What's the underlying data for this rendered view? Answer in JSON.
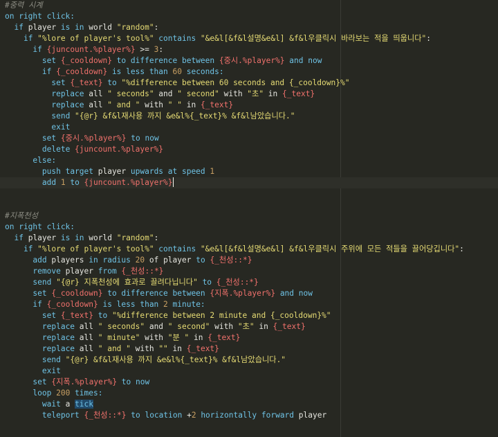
{
  "editor": {
    "lines": [
      {
        "indent": 0,
        "tokens": [
          [
            "c",
            "#중력 시계"
          ]
        ]
      },
      {
        "indent": 0,
        "tokens": [
          [
            "k",
            "on right click:"
          ]
        ]
      },
      {
        "indent": 1,
        "tokens": [
          [
            "k",
            "if "
          ],
          [
            "w",
            "player "
          ],
          [
            "k",
            "is in "
          ],
          [
            "w",
            "world "
          ],
          [
            "s",
            "\"random\""
          ],
          [
            "w",
            ":"
          ]
        ]
      },
      {
        "indent": 2,
        "tokens": [
          [
            "k",
            "if "
          ],
          [
            "s",
            "\"%lore of player's tool%\" "
          ],
          [
            "k",
            "contains "
          ],
          [
            "s",
            "\"&e&l[&f&l설명&e&l] &f&l우클릭시 바라보는 적을 띄웁니다\""
          ],
          [
            "w",
            ":"
          ]
        ]
      },
      {
        "indent": 3,
        "tokens": [
          [
            "k",
            "if "
          ],
          [
            "v",
            "{juncount.%player%}"
          ],
          [
            "w",
            " >= "
          ],
          [
            "n",
            "3"
          ],
          [
            "w",
            ":"
          ]
        ]
      },
      {
        "indent": 4,
        "tokens": [
          [
            "k",
            "set "
          ],
          [
            "v",
            "{_cooldown}"
          ],
          [
            "k",
            " to difference between "
          ],
          [
            "v",
            "{중시.%player%}"
          ],
          [
            "k",
            " and now"
          ]
        ]
      },
      {
        "indent": 4,
        "tokens": [
          [
            "k",
            "if "
          ],
          [
            "v",
            "{_cooldown}"
          ],
          [
            "k",
            " is less than "
          ],
          [
            "n",
            "60 "
          ],
          [
            "k",
            "seconds:"
          ]
        ]
      },
      {
        "indent": 5,
        "tokens": [
          [
            "k",
            "set "
          ],
          [
            "v",
            "{_text}"
          ],
          [
            "k",
            " to "
          ],
          [
            "s",
            "\"%difference between 60 seconds and {_cooldown}%\""
          ]
        ]
      },
      {
        "indent": 5,
        "tokens": [
          [
            "k",
            "replace "
          ],
          [
            "w",
            "all "
          ],
          [
            "s",
            "\" seconds\""
          ],
          [
            "w",
            " and "
          ],
          [
            "s",
            "\" second\""
          ],
          [
            "w",
            " with "
          ],
          [
            "s",
            "\"초\""
          ],
          [
            "w",
            " in "
          ],
          [
            "v",
            "{_text}"
          ]
        ]
      },
      {
        "indent": 5,
        "tokens": [
          [
            "k",
            "replace "
          ],
          [
            "w",
            "all "
          ],
          [
            "s",
            "\" and \""
          ],
          [
            "w",
            " with "
          ],
          [
            "s",
            "\" \""
          ],
          [
            "w",
            " in "
          ],
          [
            "v",
            "{_text}"
          ]
        ]
      },
      {
        "indent": 5,
        "tokens": [
          [
            "k",
            "send "
          ],
          [
            "s",
            "\"{@r} &f&l재사용 까지 &e&l%{_text}% &f&l남았습니다.\""
          ]
        ]
      },
      {
        "indent": 5,
        "tokens": [
          [
            "k",
            "exit"
          ]
        ]
      },
      {
        "indent": 4,
        "tokens": [
          [
            "k",
            "set "
          ],
          [
            "v",
            "{중시.%player%}"
          ],
          [
            "k",
            " to now"
          ]
        ]
      },
      {
        "indent": 4,
        "tokens": [
          [
            "k",
            "delete "
          ],
          [
            "v",
            "{juncount.%player%}"
          ]
        ]
      },
      {
        "indent": 3,
        "tokens": [
          [
            "k",
            "else:"
          ]
        ]
      },
      {
        "indent": 4,
        "tokens": [
          [
            "k",
            "push "
          ],
          [
            "k",
            "target "
          ],
          [
            "w",
            "player "
          ],
          [
            "k",
            "upwards at speed "
          ],
          [
            "n",
            "1"
          ]
        ]
      },
      {
        "indent": 4,
        "active": true,
        "cursor": true,
        "tokens": [
          [
            "k",
            "add "
          ],
          [
            "n",
            "1"
          ],
          [
            "k",
            " to "
          ],
          [
            "v",
            "{juncount.%player%}"
          ]
        ]
      },
      {
        "indent": 0,
        "tokens": []
      },
      {
        "indent": 0,
        "tokens": []
      },
      {
        "indent": 0,
        "tokens": [
          [
            "c",
            "#지폭천성"
          ]
        ]
      },
      {
        "indent": 0,
        "tokens": [
          [
            "k",
            "on right click:"
          ]
        ]
      },
      {
        "indent": 1,
        "tokens": [
          [
            "k",
            "if "
          ],
          [
            "w",
            "player "
          ],
          [
            "k",
            "is in "
          ],
          [
            "w",
            "world "
          ],
          [
            "s",
            "\"random\""
          ],
          [
            "w",
            ":"
          ]
        ]
      },
      {
        "indent": 2,
        "tokens": [
          [
            "k",
            "if "
          ],
          [
            "s",
            "\"%lore of player's tool%\" "
          ],
          [
            "k",
            "contains "
          ],
          [
            "s",
            "\"&e&l[&f&l설명&e&l] &f&l우클릭시 주위에 모든 적들을 끌어당깁니다\""
          ],
          [
            "w",
            ":"
          ]
        ]
      },
      {
        "indent": 3,
        "tokens": [
          [
            "k",
            "add "
          ],
          [
            "w",
            "players "
          ],
          [
            "k",
            "in radius "
          ],
          [
            "n",
            "20"
          ],
          [
            "w",
            " of "
          ],
          [
            "w",
            "player "
          ],
          [
            "k",
            "to "
          ],
          [
            "v",
            "{_천성::*}"
          ]
        ]
      },
      {
        "indent": 3,
        "tokens": [
          [
            "k",
            "remove "
          ],
          [
            "w",
            "player "
          ],
          [
            "k",
            "from "
          ],
          [
            "v",
            "{_천성::*}"
          ]
        ]
      },
      {
        "indent": 3,
        "tokens": [
          [
            "k",
            "send "
          ],
          [
            "s",
            "\"{@r} 지폭천성에 효과로 끌려다닙니다\""
          ],
          [
            "k",
            " to "
          ],
          [
            "v",
            "{_천성::*}"
          ]
        ]
      },
      {
        "indent": 3,
        "tokens": [
          [
            "k",
            "set "
          ],
          [
            "v",
            "{_cooldown}"
          ],
          [
            "k",
            " to difference between "
          ],
          [
            "v",
            "{지폭.%player%}"
          ],
          [
            "k",
            " and now"
          ]
        ]
      },
      {
        "indent": 3,
        "tokens": [
          [
            "k",
            "if "
          ],
          [
            "v",
            "{_cooldown}"
          ],
          [
            "k",
            " is less than "
          ],
          [
            "n",
            "2 "
          ],
          [
            "k",
            "minute:"
          ]
        ]
      },
      {
        "indent": 4,
        "tokens": [
          [
            "k",
            "set "
          ],
          [
            "v",
            "{_text}"
          ],
          [
            "k",
            " to "
          ],
          [
            "s",
            "\"%difference between 2 minute and {_cooldown}%\""
          ]
        ]
      },
      {
        "indent": 4,
        "tokens": [
          [
            "k",
            "replace "
          ],
          [
            "w",
            "all "
          ],
          [
            "s",
            "\" seconds\""
          ],
          [
            "w",
            " and "
          ],
          [
            "s",
            "\" second\""
          ],
          [
            "w",
            " with "
          ],
          [
            "s",
            "\"초\""
          ],
          [
            "w",
            " in "
          ],
          [
            "v",
            "{_text}"
          ]
        ]
      },
      {
        "indent": 4,
        "tokens": [
          [
            "k",
            "replace "
          ],
          [
            "w",
            "all "
          ],
          [
            "s",
            "\" minute\""
          ],
          [
            "w",
            " with "
          ],
          [
            "s",
            "\"분 \""
          ],
          [
            "w",
            " in "
          ],
          [
            "v",
            "{_text}"
          ]
        ]
      },
      {
        "indent": 4,
        "tokens": [
          [
            "k",
            "replace "
          ],
          [
            "w",
            "all "
          ],
          [
            "s",
            "\" and \""
          ],
          [
            "w",
            " with "
          ],
          [
            "s",
            "\"\""
          ],
          [
            "w",
            " in "
          ],
          [
            "v",
            "{_text}"
          ]
        ]
      },
      {
        "indent": 4,
        "tokens": [
          [
            "k",
            "send "
          ],
          [
            "s",
            "\"{@r} &f&l재사용 까지 &e&l%{_text}% &f&l남았습니다.\""
          ]
        ]
      },
      {
        "indent": 4,
        "tokens": [
          [
            "k",
            "exit"
          ]
        ]
      },
      {
        "indent": 3,
        "tokens": [
          [
            "k",
            "set "
          ],
          [
            "v",
            "{지폭.%player%}"
          ],
          [
            "k",
            " to now"
          ]
        ]
      },
      {
        "indent": 3,
        "tokens": [
          [
            "k",
            "loop "
          ],
          [
            "n",
            "200"
          ],
          [
            "k",
            " times:"
          ]
        ]
      },
      {
        "indent": 4,
        "tokens": [
          [
            "k",
            "wait "
          ],
          [
            "w",
            "a "
          ],
          [
            "sel",
            "tick"
          ]
        ]
      },
      {
        "indent": 4,
        "tokens": [
          [
            "k",
            "teleport "
          ],
          [
            "v",
            "{_천성::*}"
          ],
          [
            "k",
            " to location "
          ],
          [
            "w",
            "+"
          ],
          [
            "n",
            "2"
          ],
          [
            "k",
            " horizontally forward "
          ],
          [
            "w",
            "player"
          ]
        ]
      }
    ]
  }
}
